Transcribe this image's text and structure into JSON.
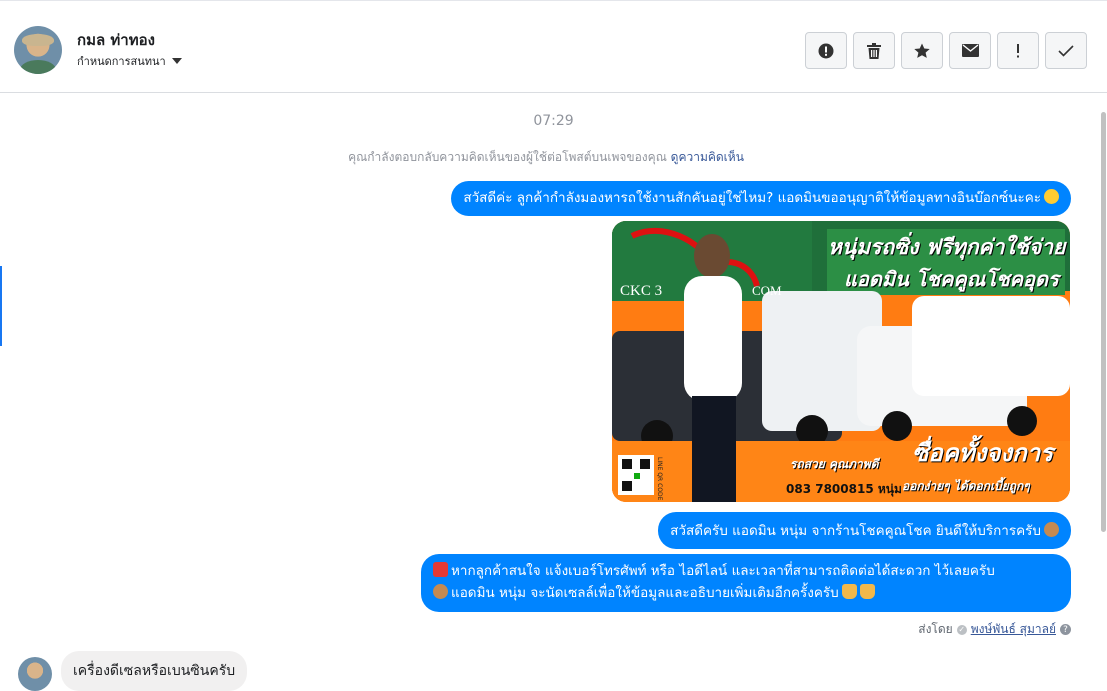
{
  "header": {
    "contact_name": "กมล ท่าทอง",
    "assign_label": "กำหนดการสนทนา",
    "action_buttons": [
      {
        "name": "spam-button",
        "icon": "alert-circle-icon"
      },
      {
        "name": "delete-button",
        "icon": "trash-icon"
      },
      {
        "name": "star-button",
        "icon": "star-icon"
      },
      {
        "name": "mark-unread-button",
        "icon": "envelope-icon"
      },
      {
        "name": "follow-up-button",
        "icon": "exclamation-icon"
      },
      {
        "name": "done-button",
        "icon": "check-icon"
      }
    ]
  },
  "thread": {
    "timestamp": "07:29",
    "notice_text": "คุณกำลังตอบกลับความคิดเห็นของผู้ใช้ต่อโพสต์บนเพจของคุณ",
    "notice_link": "ดูความคิดเห็น",
    "msg1": "สวัสดีค่ะ ลูกค้ากำลังมองหารถใช้งานสักคันอยู่ใช่ไหม? แอดมินขออนุญาติให้ข้อมูลทางอินบ๊อกซ์นะคะ",
    "image": {
      "headline1": "หนุ่มรถซิ่ง ฟรีทุกค่าใช้จ่าย",
      "headline2": "แอดมิน โชคคูณโชคอุดร",
      "brand": "CKC 3",
      "brand_suffix": "COM",
      "slogan1": "ซื่อคทั้งจงการ",
      "slogan2": "รถสวย คุณภาพดี",
      "phone": "083 7800815",
      "phone_name": "หนุ่ม",
      "slogan3": "ออกง่ายๆ ได้ดอกเบี้ยถูกๆ",
      "qr_label": "LINE QR CODE"
    },
    "msg2": "สวัสดีครับ แอดมิน หนุ่ม จากร้านโชคคูณโชค ยินดีให้บริการครับ",
    "msg3_line1": "หากลูกค้าสนใจ แจ้งเบอร์โทรศัพท์ หรือ ไอดีไลน์ และเวลาที่สามารถติดต่อได้สะดวก ไว้เลยครับ",
    "msg3_line2": "แอดมิน หนุ่ม จะนัดเซลล์เพื่อให้ข้อมูลและอธิบายเพิ่มเติมอีกครั้งครับ",
    "sent_by_label": "ส่งโดย",
    "sent_by_name": "พงษ์พันธ์ สุมาลย์",
    "incoming_msg": "เครื่องดีเซลหรือเบนซินครับ"
  },
  "colors": {
    "outgoing_bubble": "#0084ff",
    "incoming_bubble": "#f1f0f0",
    "link": "#385898"
  }
}
